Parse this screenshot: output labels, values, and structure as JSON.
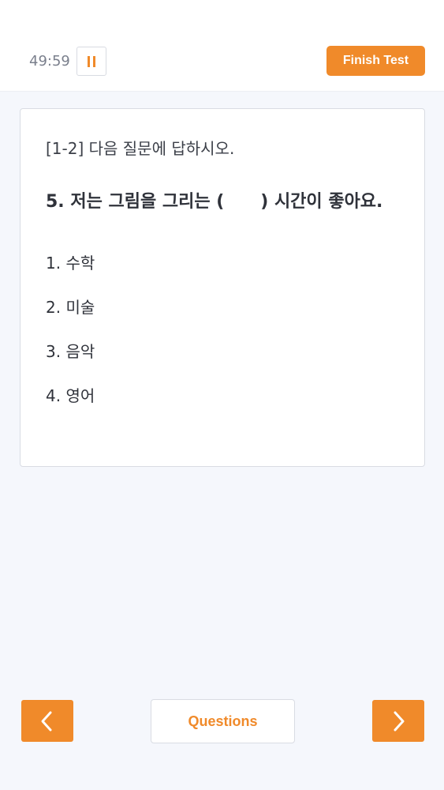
{
  "header": {
    "timer": "49:59",
    "pause_icon": "pause-icon",
    "finish_label": "Finish Test"
  },
  "question_card": {
    "instruction": "[1-2]  다음 질문에 답하시오.",
    "question": "5. 저는 그림을 그리는 (      ) 시간이 좋아요.",
    "options": [
      "1. 수학",
      "2. 미술",
      "3. 음악",
      "4. 영어"
    ]
  },
  "footer": {
    "prev_icon": "chevron-left-icon",
    "next_icon": "chevron-right-icon",
    "questions_label": "Questions"
  },
  "colors": {
    "accent": "#f08a2a",
    "background": "#f5f7fc",
    "card": "#ffffff",
    "text": "#2f323a",
    "muted": "#7a7f8c"
  }
}
